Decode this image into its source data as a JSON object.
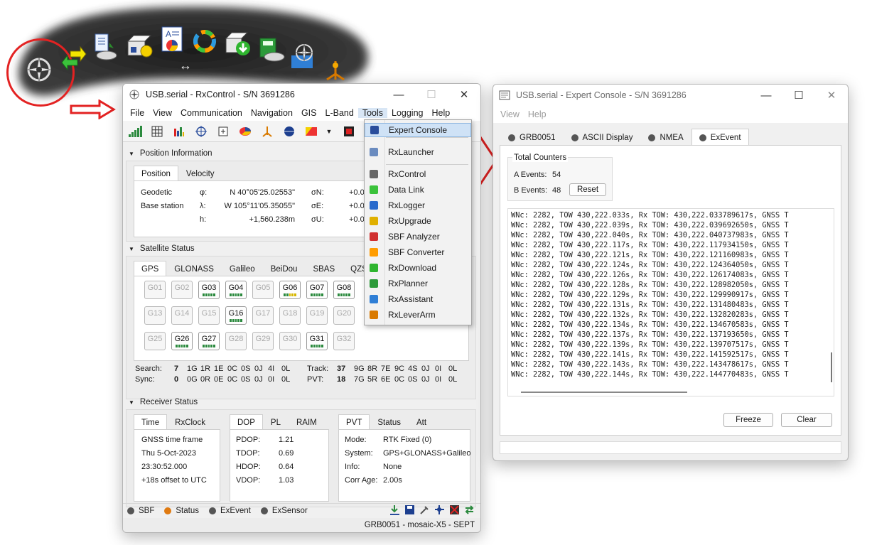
{
  "launcher": {
    "icons": [
      "rxcontrol-icon",
      "data-link-icon",
      "rxlogger-icon",
      "rxupgrade-icon",
      "sbf-analyzer-icon",
      "sbf-converter-icon",
      "rxdownload-icon",
      "rxplanner-icon",
      "rxassistant-icon",
      "rxleverarm-icon"
    ],
    "move_glyph": "↔"
  },
  "rxcontrol": {
    "title": "USB.serial - RxControl - S/N 3691286",
    "menu": [
      "File",
      "View",
      "Communication",
      "Navigation",
      "GIS",
      "L-Band",
      "Tools",
      "Logging",
      "Help"
    ],
    "position": {
      "header": "Position Information",
      "tabs": [
        "Position",
        "Velocity"
      ],
      "rows": [
        {
          "label": "Geodetic",
          "sym": "φ:",
          "value": "N 40°05'25.02553\"",
          "sigma": "σN:",
          "sval": "+0.0"
        },
        {
          "label": "Base station",
          "sym": "λ:",
          "value": "W 105°11'05.35055\"",
          "sigma": "σE:",
          "sval": "+0.0"
        },
        {
          "label": "",
          "sym": "h:",
          "value": "+1,560.238m",
          "sigma": "σU:",
          "sval": "+0.0"
        }
      ]
    },
    "satellites": {
      "header": "Satellite Status",
      "tabs": [
        "GPS",
        "GLONASS",
        "Galileo",
        "BeiDou",
        "SBAS",
        "QZSS"
      ],
      "rows": [
        [
          "G01",
          "G02",
          "G03",
          "G04",
          "G05",
          "G06",
          "G07",
          "G08"
        ],
        [
          "G13",
          "G14",
          "G15",
          "G16",
          "G17",
          "G18",
          "G19",
          "G20"
        ],
        [
          "G25",
          "G26",
          "G27",
          "G28",
          "G29",
          "G30",
          "G31",
          "G32"
        ]
      ],
      "active": [
        "G03",
        "G04",
        "G06",
        "G07",
        "G08",
        "G16",
        "G26",
        "G27",
        "G31"
      ],
      "search_label": "Search:",
      "search_total": "7",
      "search_counts": [
        "1G",
        "1R",
        "1E",
        "0C",
        "0S",
        "0J",
        "4I",
        "0L"
      ],
      "sync_label": "Sync:",
      "sync_total": "0",
      "sync_counts": [
        "0G",
        "0R",
        "0E",
        "0C",
        "0S",
        "0J",
        "0I",
        "0L"
      ],
      "track_label": "Track:",
      "track_total": "37",
      "track_counts": [
        "9G",
        "8R",
        "7E",
        "9C",
        "4S",
        "0J",
        "0I",
        "0L"
      ],
      "pvt_label": "PVT:",
      "pvt_total": "18",
      "pvt_counts": [
        "7G",
        "5R",
        "6E",
        "0C",
        "0S",
        "0J",
        "0I",
        "0L"
      ]
    },
    "receiver": {
      "header": "Receiver Status",
      "time_tabs": [
        "Time",
        "RxClock"
      ],
      "time_lines": [
        "GNSS time frame",
        "Thu 5-Oct-2023",
        "23:30:52.000",
        "+18s offset to UTC"
      ],
      "dop_tabs": [
        "DOP",
        "PL",
        "RAIM"
      ],
      "dop": [
        [
          "PDOP:",
          "1.21"
        ],
        [
          "TDOP:",
          "0.69"
        ],
        [
          "HDOP:",
          "0.64"
        ],
        [
          "VDOP:",
          "1.03"
        ]
      ],
      "pvt_tabs": [
        "PVT",
        "Status",
        "Att"
      ],
      "pvt": [
        [
          "Mode:",
          "RTK Fixed (0)"
        ],
        [
          "System:",
          "GPS+GLONASS+Galileo"
        ],
        [
          "Info:",
          "None"
        ],
        [
          "Corr Age:",
          "2.00s"
        ]
      ]
    },
    "status_items": [
      "SBF",
      "Status",
      "ExEvent",
      "ExSensor"
    ],
    "footer": "GRB0051 - mosaic-X5 - SEPT"
  },
  "tools_menu": {
    "items": [
      {
        "label": "Expert Console",
        "icon": "console-icon"
      },
      {
        "label": "RxLauncher",
        "icon": "launcher-icon"
      },
      {
        "label": "RxControl",
        "icon": "rxcontrol-icon"
      },
      {
        "label": "Data Link",
        "icon": "data-link-icon"
      },
      {
        "label": "RxLogger",
        "icon": "rxlogger-icon"
      },
      {
        "label": "RxUpgrade",
        "icon": "rxupgrade-icon"
      },
      {
        "label": "SBF Analyzer",
        "icon": "sbf-analyzer-icon"
      },
      {
        "label": "SBF Converter",
        "icon": "sbf-converter-icon"
      },
      {
        "label": "RxDownload",
        "icon": "rxdownload-icon"
      },
      {
        "label": "RxPlanner",
        "icon": "rxplanner-icon"
      },
      {
        "label": "RxAssistant",
        "icon": "rxassistant-icon"
      },
      {
        "label": "RxLeverArm",
        "icon": "rxleverarm-icon"
      }
    ]
  },
  "console": {
    "title": "USB.serial - Expert Console - S/N 3691286",
    "menu": [
      "View",
      "Help"
    ],
    "tabs": [
      "GRB0051",
      "ASCII Display",
      "NMEA",
      "ExEvent"
    ],
    "counters_title": "Total Counters",
    "a_events_label": "A Events:",
    "a_events": "54",
    "b_events_label": "B Events:",
    "b_events": "48",
    "reset_label": "Reset",
    "lines": [
      "WNc: 2282, TOW 430,222.033s, Rx TOW: 430,222.033789617s, GNSS T",
      "WNc: 2282, TOW 430,222.039s, Rx TOW: 430,222.039692650s, GNSS T",
      "WNc: 2282, TOW 430,222.040s, Rx TOW: 430,222.040737983s, GNSS T",
      "WNc: 2282, TOW 430,222.117s, Rx TOW: 430,222.117934150s, GNSS T",
      "WNc: 2282, TOW 430,222.121s, Rx TOW: 430,222.121160983s, GNSS T",
      "WNc: 2282, TOW 430,222.124s, Rx TOW: 430,222.124364050s, GNSS T",
      "WNc: 2282, TOW 430,222.126s, Rx TOW: 430,222.126174083s, GNSS T",
      "WNc: 2282, TOW 430,222.128s, Rx TOW: 430,222.128982050s, GNSS T",
      "WNc: 2282, TOW 430,222.129s, Rx TOW: 430,222.129990917s, GNSS T",
      "WNc: 2282, TOW 430,222.131s, Rx TOW: 430,222.131480483s, GNSS T",
      "WNc: 2282, TOW 430,222.132s, Rx TOW: 430,222.132820283s, GNSS T",
      "WNc: 2282, TOW 430,222.134s, Rx TOW: 430,222.134670583s, GNSS T",
      "WNc: 2282, TOW 430,222.137s, Rx TOW: 430,222.137193650s, GNSS T",
      "WNc: 2282, TOW 430,222.139s, Rx TOW: 430,222.139707517s, GNSS T",
      "WNc: 2282, TOW 430,222.141s, Rx TOW: 430,222.141592517s, GNSS T",
      "WNc: 2282, TOW 430,222.143s, Rx TOW: 430,222.143478617s, GNSS T",
      "WNc: 2282, TOW 430,222.144s, Rx TOW: 430,222.144770483s, GNSS T"
    ],
    "freeze_label": "Freeze",
    "clear_label": "Clear"
  },
  "colors": {
    "annotation_red": "#e32222",
    "menu_highlight": "#cfe2f6",
    "signal_green": "#2b8a3e"
  }
}
